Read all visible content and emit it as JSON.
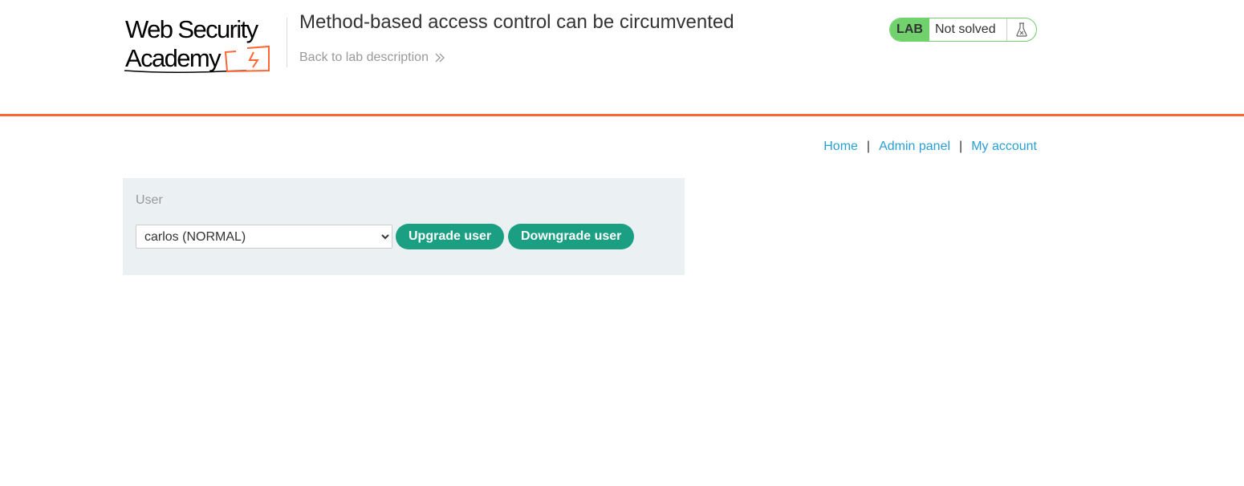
{
  "header": {
    "logo_alt": "Web Security Academy",
    "logo_line1": "Web Security",
    "logo_line2": "Academy",
    "lab_title": "Method-based access control can be circumvented",
    "back_link_label": "Back to lab description",
    "lab_badge": "LAB",
    "lab_status": "Not solved",
    "accent_color": "#ff6633",
    "status_color": "#70d16d"
  },
  "nav": {
    "home": "Home",
    "separator": "|",
    "admin_panel": "Admin panel",
    "my_account": "My account",
    "link_color": "#29a0d4"
  },
  "admin_form": {
    "user_label": "User",
    "selected_user": "carlos (NORMAL)",
    "upgrade_label": "Upgrade user",
    "downgrade_label": "Downgrade user",
    "button_color": "#1a9f82"
  },
  "icons": {
    "back_chevron": "double-chevron-right-icon",
    "lab_icon": "flask-icon"
  }
}
